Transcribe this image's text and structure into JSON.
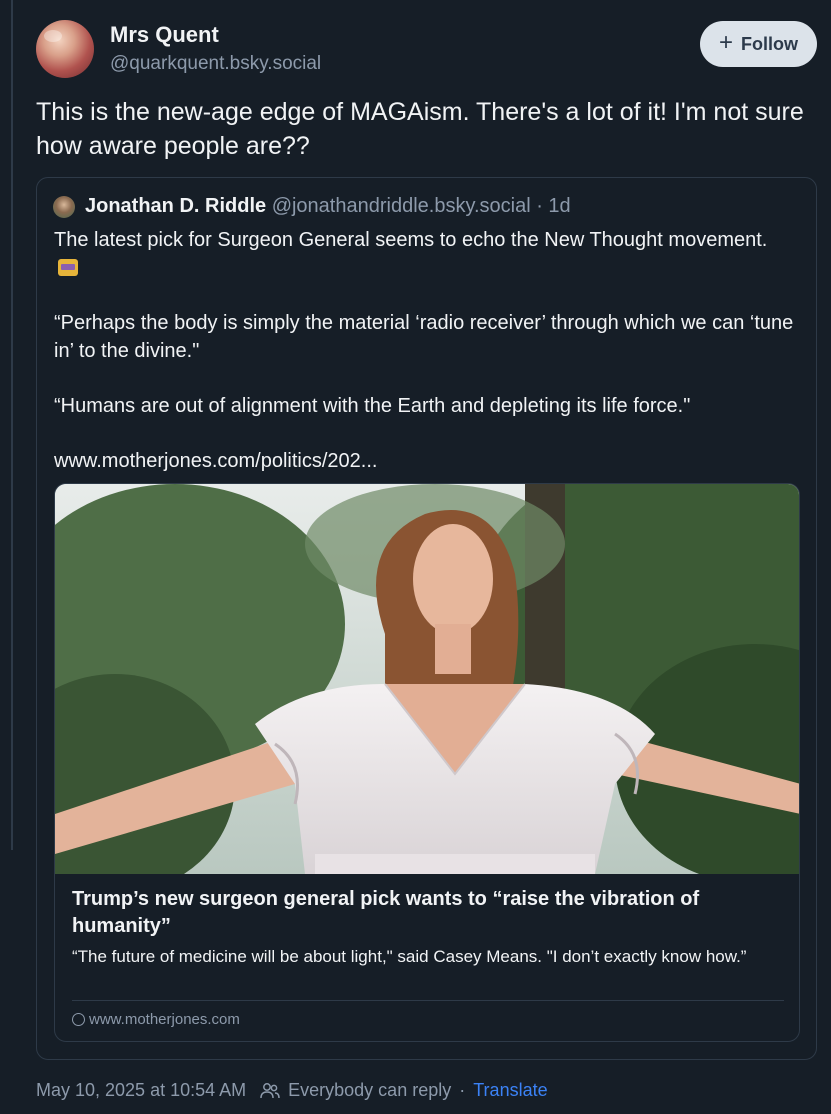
{
  "author": {
    "display_name": "Mrs Quent",
    "handle": "@quarkquent.bsky.social"
  },
  "follow_button": {
    "label": "Follow"
  },
  "post": {
    "text": "This is the new-age edge of MAGAism. There's a lot of it! I'm not sure how aware people are??"
  },
  "quote": {
    "display_name": "Jonathan D. Riddle",
    "handle": "@jonathandriddle.bsky.social",
    "age": " · 1d",
    "paragraphs": [
      "The latest pick for Surgeon General seems to echo the New Thought movement.",
      "“Perhaps the body is simply the material ‘radio receiver’ through which we can ‘tune in’ to the divine.\"",
      "“Humans are out of alignment with the Earth and depleting its life force.\"",
      "www.motherjones.com/politics/202..."
    ],
    "link_card": {
      "title": "Trump’s new surgeon general pick wants to “raise the vibration of humanity”",
      "description": "“The future of medicine will be about light,\" said Casey Means. \"I don’t exactly know how.”",
      "domain": "www.motherjones.com"
    }
  },
  "footer": {
    "timestamp": "May 10, 2025 at 10:54 AM",
    "reply_setting": "Everybody can reply",
    "separator": "·",
    "translate_label": "Translate"
  },
  "colors": {
    "background": "#161e27",
    "accent": "#3b82f6",
    "muted": "#8d9aab"
  }
}
